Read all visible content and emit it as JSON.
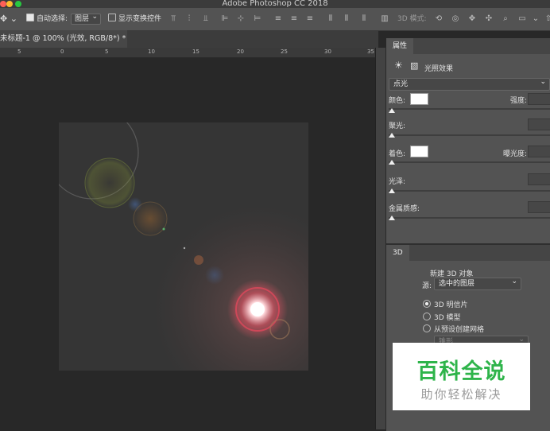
{
  "window": {
    "title": "Adobe Photoshop CC 2018"
  },
  "options_bar": {
    "auto_select_label": "自动选择:",
    "auto_select_value": "图层",
    "show_transform_label": "显示变换控件",
    "mode_3d_label": "3D 模式:"
  },
  "document": {
    "tab_title": "未标题-1 @ 100% (光效, RGB/8*) *"
  },
  "ruler": {
    "labels": [
      "5",
      "0",
      "5",
      "10",
      "15",
      "20",
      "25",
      "30",
      "35"
    ]
  },
  "properties": {
    "tab_label": "属性",
    "header_label": "光照效果",
    "light_type": "点光",
    "color_label": "颜色:",
    "intensity_label": "强度:",
    "hotspot_label": "聚光:",
    "colorize_label": "着色:",
    "exposure_label": "曝光度:",
    "gloss_label": "光泽:",
    "metallic_label": "金属质感:"
  },
  "panel_3d": {
    "tab_label": "3D",
    "new_object_label": "新建 3D 对象",
    "source_label": "源:",
    "source_value": "选中的图层",
    "options": [
      "3D 明信片",
      "3D 模型",
      "从预设创建网格"
    ],
    "selected_option": "3D 明信片",
    "mesh_preset_value": "锥形"
  },
  "watermark": {
    "title": "百科全说",
    "subtitle": "助你轻松解决"
  },
  "colors": {
    "accent_green": "#2eb44a",
    "panel_bg": "#535353",
    "canvas_bg": "#282828"
  }
}
